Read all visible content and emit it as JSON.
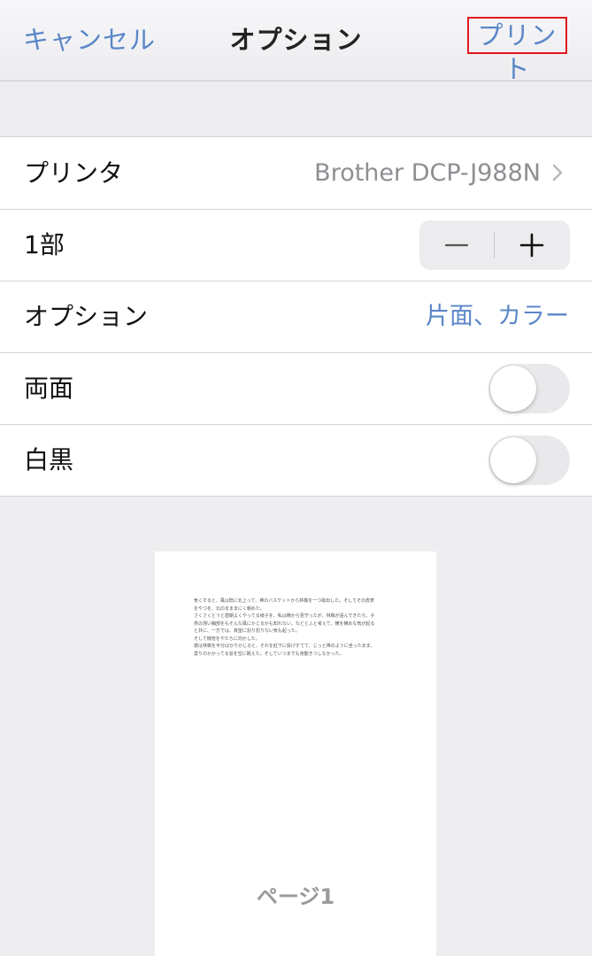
{
  "navbar": {
    "cancel_label": "キャンセル",
    "title": "オプション",
    "print_label": "プリント"
  },
  "settings": {
    "printer": {
      "label": "プリンタ",
      "value": "Brother DCP-J988N"
    },
    "copies": {
      "label": "1部"
    },
    "options": {
      "label": "オプション",
      "value": "片面、カラー"
    },
    "duplex": {
      "label": "両面",
      "on": false
    },
    "mono": {
      "label": "白黒",
      "on": false
    }
  },
  "preview": {
    "page_label": "ページ1",
    "text_lines": [
      "気くすると、風は既に北上って、棒のバスケットから林檎を一つ取出した。そしてその皮表",
      "をやつを、北のまままにく朝めた。",
      "さくさくとうと歯朝よくやってる様子を、私は横から見守ったが、林檎が遠んできたら、子",
      "供の滞い胸部をもそんな風にかじるかも知れない、などとふと考えて、横を横めな気が起る",
      "と共に、一方では、真望に割り罰りない気も起った。",
      "そして機管をやたらに向かした。",
      "彼は林檎を半分ばかりかじると、それを紅下に投げすてて、じっと棒のように坐ったまま、",
      "雲りのかかってる窓を空に眺えた。そしていつまでも身動きつしなかった。"
    ]
  },
  "colors": {
    "accent": "#5a86c7",
    "highlight_border": "#e0181e",
    "background": "#eeeef1"
  }
}
